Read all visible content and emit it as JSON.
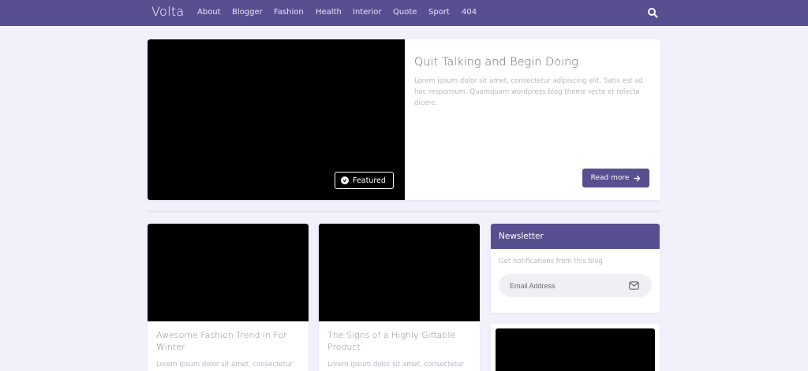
{
  "brand": "Volta",
  "nav": [
    "About",
    "Blogger",
    "Fashion",
    "Health",
    "Interior",
    "Quote",
    "Sport",
    "404"
  ],
  "featured": {
    "title": "Quit Talking and Begin Doing",
    "excerpt": "Lorem ipsum dolor sit amet, consectetur adipiscing elit. Satis est ad hoc responsum. Quamquam wordpress blog theme recte et relecta dicere.",
    "badge": "Featured",
    "read_more": "Read more"
  },
  "posts": [
    {
      "title": "Awesome Fashion Trend in For Winter",
      "excerpt": "Lorem ipsum dolor sit amet, consectetur"
    },
    {
      "title": "The Signs of a Highly Giftable Product",
      "excerpt": "Lorem ipsum dolor sit amet, consectetur"
    }
  ],
  "newsletter": {
    "title": "Newsletter",
    "text": "Get notifications from this blog",
    "placeholder": "Email Address"
  },
  "colors": {
    "accent": "#584f91",
    "background": "#f1f0fb"
  },
  "icons": {
    "search": "search-icon",
    "check": "check-circle-icon",
    "arrow": "arrow-right-icon",
    "mail": "mail-icon"
  }
}
